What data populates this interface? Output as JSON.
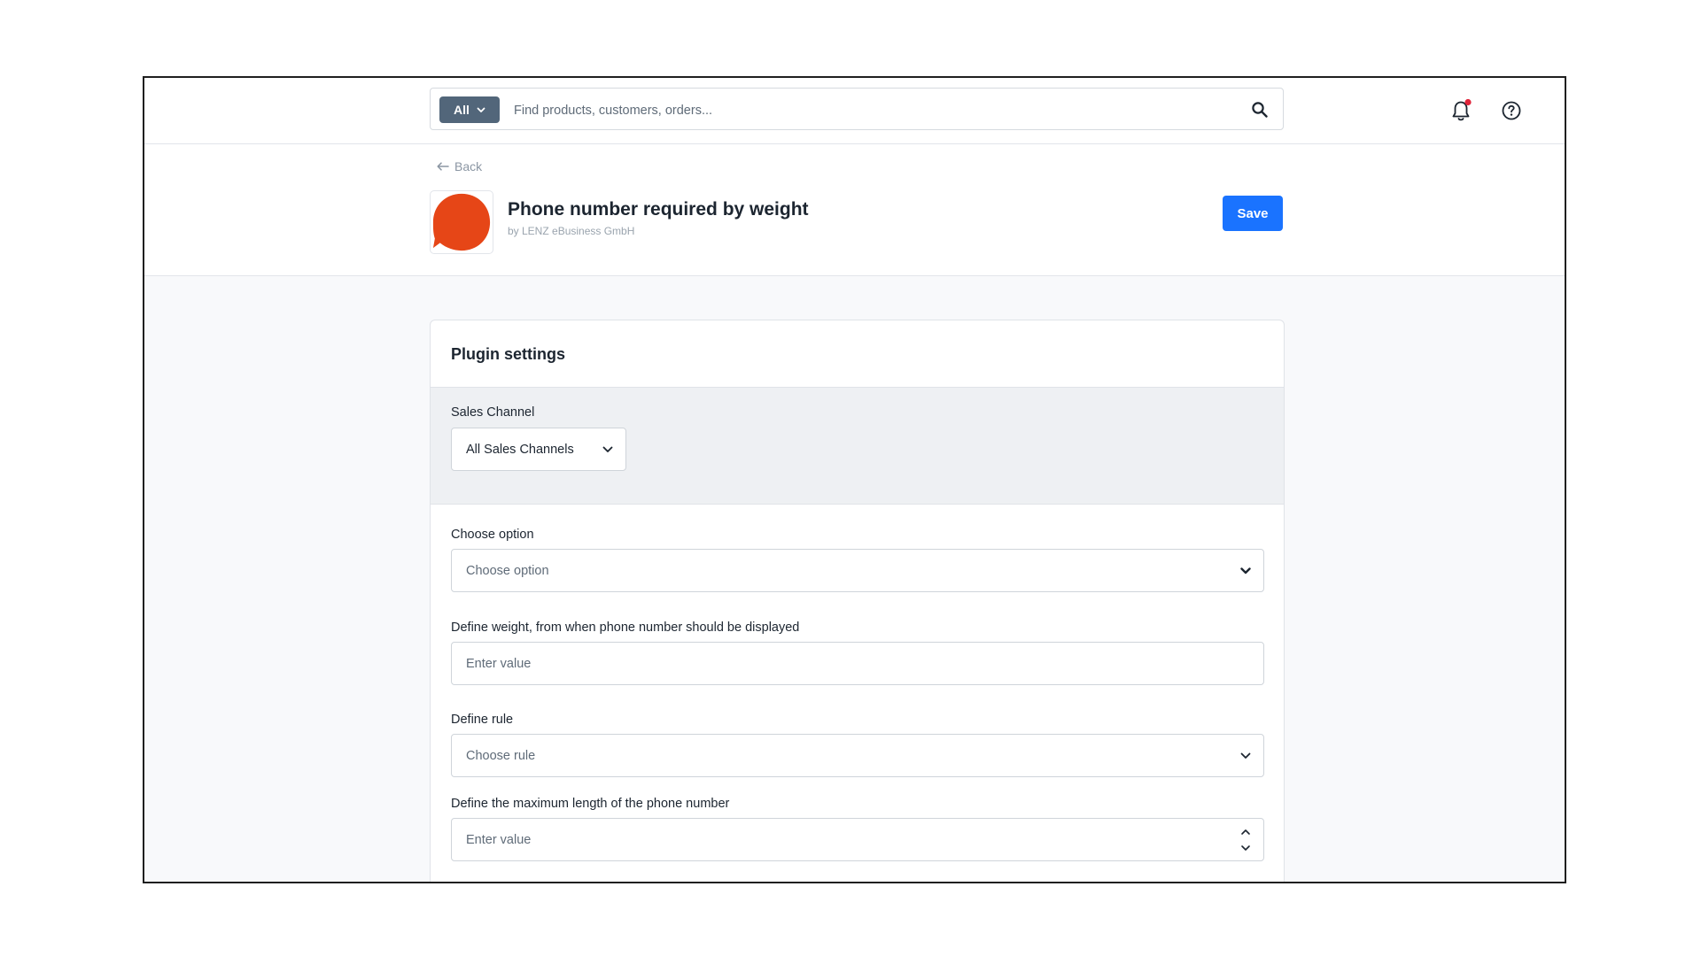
{
  "search": {
    "type_label": "All",
    "placeholder": "Find products, customers, orders..."
  },
  "header": {
    "back_label": "Back",
    "plugin_title": "Phone number required by weight",
    "plugin_vendor": "by LENZ eBusiness GmbH",
    "save_label": "Save"
  },
  "card": {
    "title": "Plugin settings",
    "sales_channel": {
      "label": "Sales Channel",
      "value": "All Sales Channels"
    },
    "fields": [
      {
        "label": "Choose option",
        "placeholder": "Choose option",
        "kind": "select"
      },
      {
        "label": "Define weight, from when phone number should be displayed",
        "placeholder": "Enter value",
        "kind": "text"
      },
      {
        "label": "Define rule",
        "placeholder": "Choose rule",
        "kind": "select"
      },
      {
        "label": "Define the maximum length of the phone number",
        "placeholder": "Enter value",
        "kind": "number"
      }
    ]
  },
  "colors": {
    "primary": "#1a73ff",
    "search_type_bg": "#52667a",
    "plugin_logo": "#e64617",
    "notification_dot": "#e0243a",
    "section_bg": "#eef0f3"
  },
  "icons": {
    "search": "search-icon",
    "notifications": "bell-icon",
    "help": "help-icon",
    "back": "arrow-left-icon",
    "dropdown": "chevron-down-icon",
    "stepper": "stepper-icon"
  }
}
